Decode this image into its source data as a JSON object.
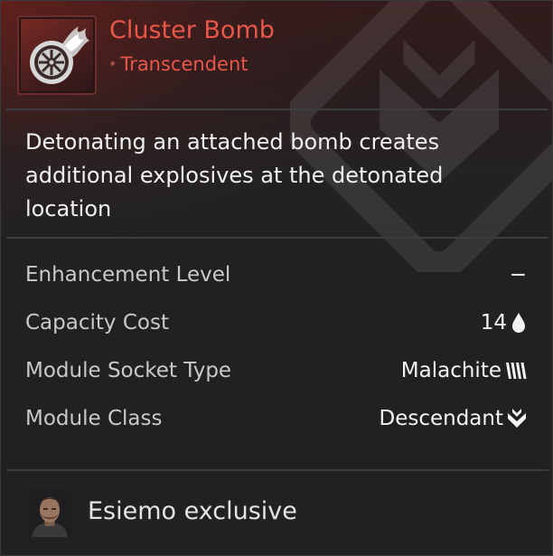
{
  "module": {
    "name": "Cluster Bomb",
    "rarity": "Transcendent",
    "icon": "wheel-flame-module-icon",
    "description": "Detonating an attached bomb creates additional explosives at the detonated location"
  },
  "stats": [
    {
      "label": "Enhancement Level",
      "value": "−",
      "icon": ""
    },
    {
      "label": "Capacity Cost",
      "value": "14",
      "icon": "droplet-icon"
    },
    {
      "label": "Module Socket Type",
      "value": "Malachite",
      "icon": "malachite-socket-icon"
    },
    {
      "label": "Module Class",
      "value": "Descendant",
      "icon": "descendant-class-icon"
    }
  ],
  "footer": {
    "text": "Esiemo exclusive",
    "avatar": "esiemo-portrait"
  },
  "colors": {
    "rarity": "#e8574a",
    "background": "#212123",
    "text": "#f1f1f1",
    "label": "#c9c9c9"
  }
}
